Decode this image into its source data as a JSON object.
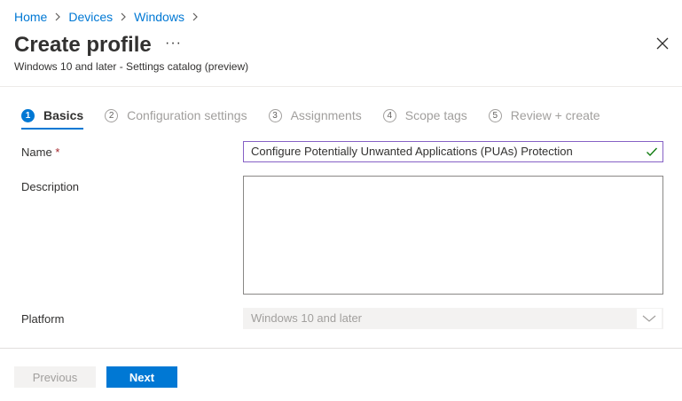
{
  "breadcrumb": [
    "Home",
    "Devices",
    "Windows"
  ],
  "header": {
    "title": "Create profile",
    "more_label": "···",
    "subtitle": "Windows 10 and later - Settings catalog (preview)"
  },
  "steps": [
    {
      "number": "1",
      "label": "Basics",
      "active": true
    },
    {
      "number": "2",
      "label": "Configuration settings",
      "active": false
    },
    {
      "number": "3",
      "label": "Assignments",
      "active": false
    },
    {
      "number": "4",
      "label": "Scope tags",
      "active": false
    },
    {
      "number": "5",
      "label": "Review + create",
      "active": false
    }
  ],
  "form": {
    "name_label": "Name",
    "required_mark": "*",
    "name_value": "Configure Potentially Unwanted Applications (PUAs) Protection",
    "description_label": "Description",
    "description_value": "",
    "platform_label": "Platform",
    "platform_value": "Windows 10 and later"
  },
  "footer": {
    "previous_label": "Previous",
    "next_label": "Next"
  },
  "colors": {
    "accent": "#0078d4",
    "valid": "#107c10",
    "required": "#a4262c",
    "input_focus_border": "#8661c5"
  },
  "icons": {
    "breadcrumb_separator": "chevron-right-icon",
    "close": "close-icon",
    "valid": "checkmark-icon",
    "dropdown": "chevron-down-icon"
  }
}
